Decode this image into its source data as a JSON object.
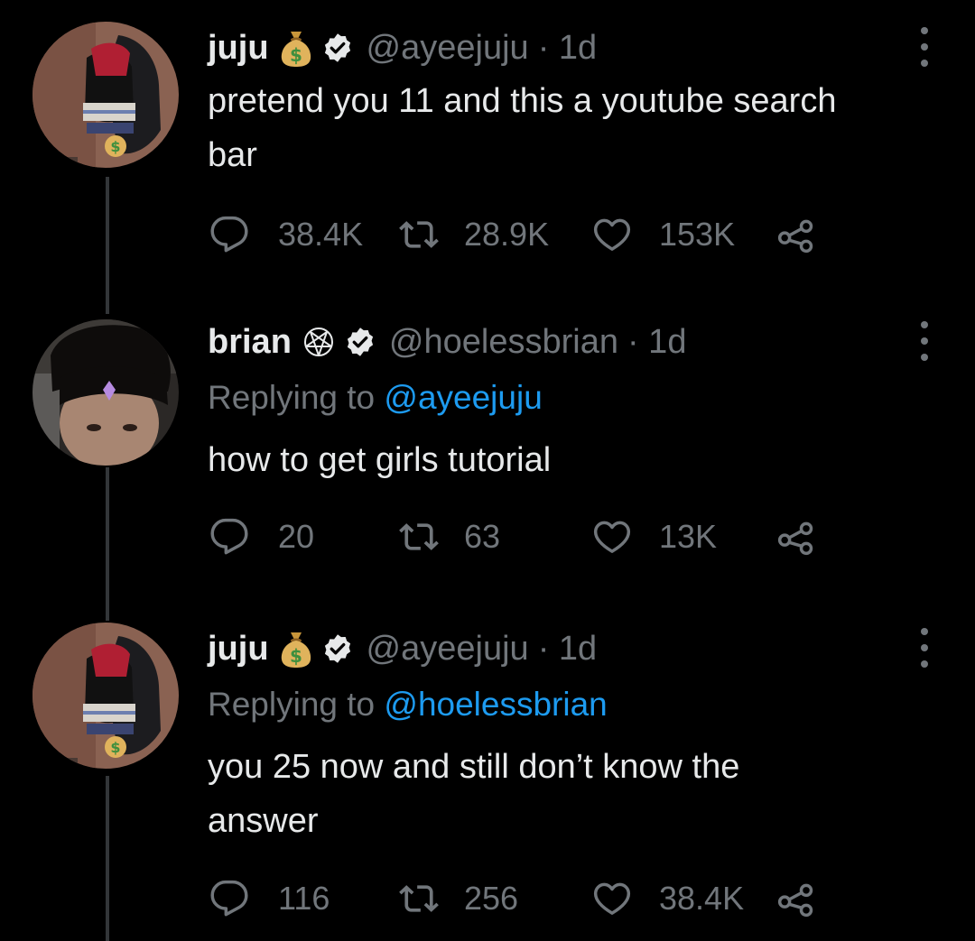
{
  "colors": {
    "background": "#000000",
    "text": "#e7e9ea",
    "muted": "#71767b",
    "link": "#1d9bf0",
    "thread_line": "#333639"
  },
  "tweets": [
    {
      "name": "juju",
      "name_emoji": "money-bag-icon",
      "verified": true,
      "handle": "@ayeejuju",
      "time": "· 1d",
      "replying_label": "",
      "replying_mention": "",
      "text_lines": [
        "pretend you 11 and this a youtube search",
        "bar"
      ],
      "replies": "38.4K",
      "retweets": "28.9K",
      "likes": "153K"
    },
    {
      "name": "brian",
      "name_emoji": "pentagram-icon",
      "verified": true,
      "handle": "@hoelessbrian",
      "time": "· 1d",
      "replying_label": "Replying to",
      "replying_mention": "@ayeejuju",
      "text_lines": [
        "how to get girls tutorial"
      ],
      "replies": "20",
      "retweets": "63",
      "likes": "13K"
    },
    {
      "name": "juju",
      "name_emoji": "money-bag-icon",
      "verified": true,
      "handle": "@ayeejuju",
      "time": "· 1d",
      "replying_label": "Replying to",
      "replying_mention": "@hoelessbrian",
      "text_lines": [
        "you 25 now and still don’t know the",
        "answer"
      ],
      "replies": "116",
      "retweets": "256",
      "likes": "38.4K"
    }
  ]
}
